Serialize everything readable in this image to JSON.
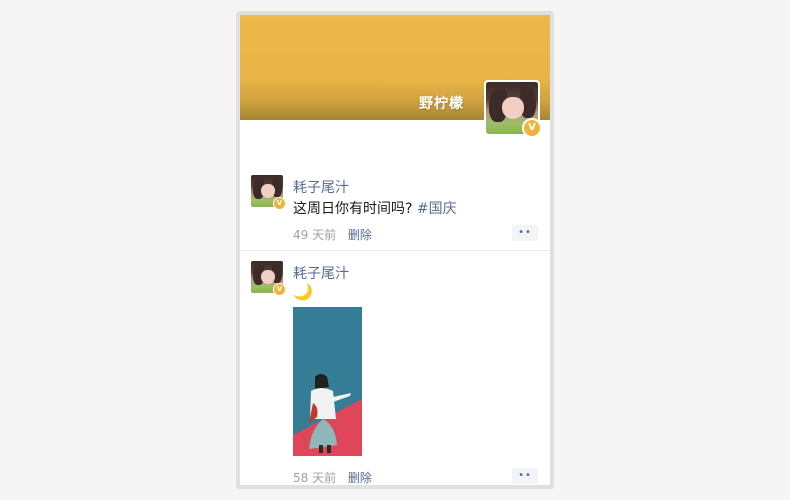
{
  "profile": {
    "name": "野柠檬",
    "badge": "V",
    "cover_color": "#ebb748"
  },
  "posts": [
    {
      "author": "耗子尾汁",
      "text": "这周日你有时间吗?",
      "tag": "#国庆",
      "time": "49 天前",
      "delete_label": "删除",
      "more_label": "••",
      "badge": "V"
    },
    {
      "author": "耗子尾汁",
      "text": "🌙",
      "image": "illustration-girl-walking",
      "time": "58 天前",
      "delete_label": "删除",
      "more_label": "••",
      "badge": "V"
    }
  ],
  "colors": {
    "link": "#576b95",
    "time": "#a0a0a0",
    "badge": "#f0b23a"
  }
}
